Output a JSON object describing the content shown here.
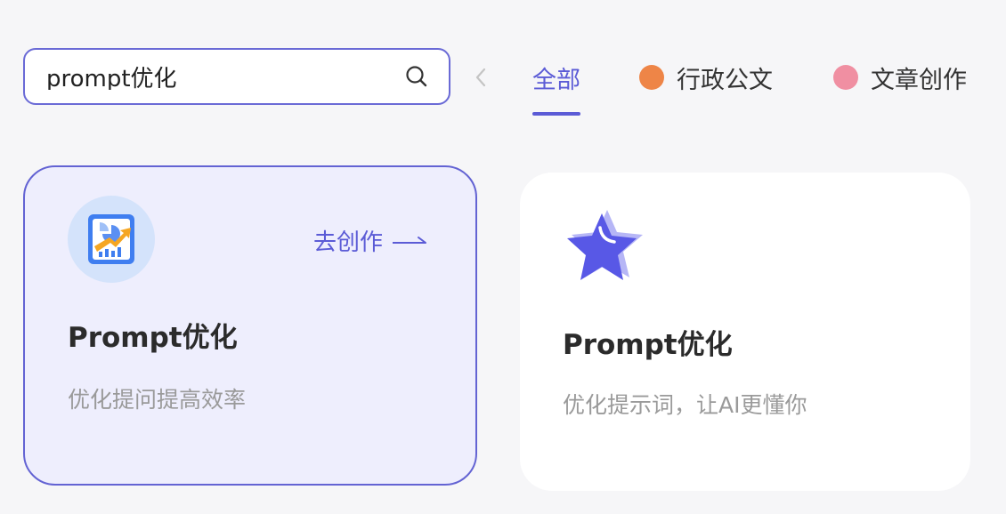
{
  "search": {
    "value": "prompt优化"
  },
  "tabs": [
    {
      "label": "全部",
      "active": true
    },
    {
      "label": "行政公文",
      "dot_color": "#ee8547"
    },
    {
      "label": "文章创作",
      "dot_color": "#f08fa2"
    }
  ],
  "cards": [
    {
      "title": "Prompt优化",
      "description": "优化提问提高效率",
      "action_label": "去创作",
      "icon": "chart-report-icon"
    },
    {
      "title": "Prompt优化",
      "description": "优化提示词，让AI更懂你",
      "icon": "star-icon"
    }
  ],
  "colors": {
    "accent": "#5b5bd6",
    "card_active_bg": "#eeeefd",
    "page_bg": "#f6f6f8"
  }
}
